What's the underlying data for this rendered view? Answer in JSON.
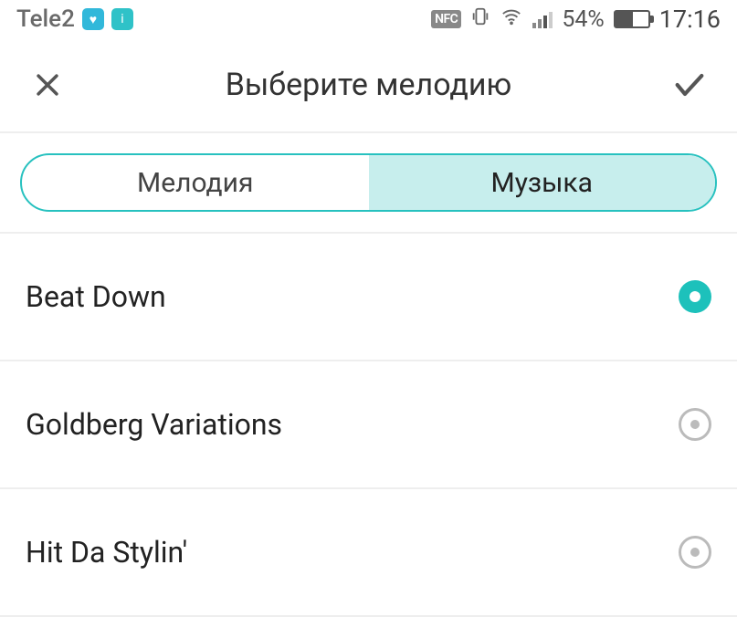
{
  "status": {
    "carrier": "Tele2",
    "nfc": "NFC",
    "battery_pct": "54%",
    "time": "17:16"
  },
  "header": {
    "title": "Выберите мелодию"
  },
  "tabs": {
    "melody": "Мелодия",
    "music": "Музыка",
    "active": "music"
  },
  "list": {
    "items": [
      {
        "label": "Beat Down",
        "selected": true
      },
      {
        "label": "Goldberg Variations",
        "selected": false
      },
      {
        "label": "Hit Da Stylin'",
        "selected": false
      }
    ]
  },
  "colors": {
    "accent": "#1dc1bb"
  }
}
